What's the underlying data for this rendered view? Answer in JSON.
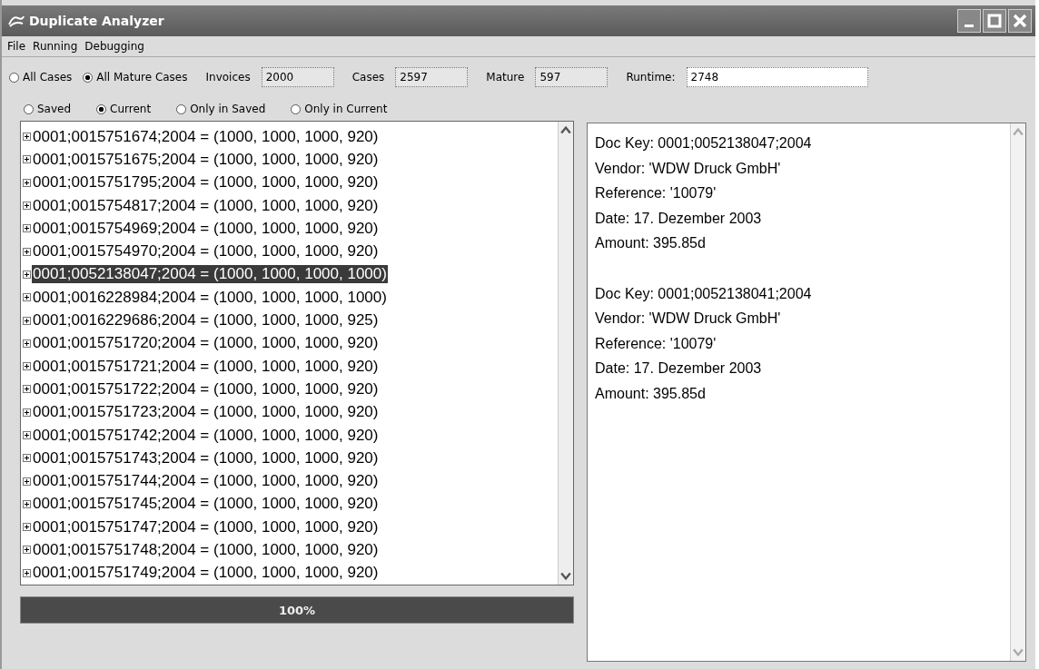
{
  "window": {
    "title": "Duplicate Analyzer"
  },
  "menu": [
    "File",
    "Running",
    "Debugging"
  ],
  "scope": [
    {
      "label": "All Cases",
      "selected": false
    },
    {
      "label": "All Mature Cases",
      "selected": true
    }
  ],
  "stats": [
    {
      "label": "Invoices",
      "value": "2000"
    },
    {
      "label": "Cases",
      "value": "2597"
    },
    {
      "label": "Mature",
      "value": "597"
    },
    {
      "label": "Runtime:",
      "value": "2748"
    }
  ],
  "view": [
    {
      "label": "Saved",
      "selected": false
    },
    {
      "label": "Current",
      "selected": true
    },
    {
      "label": "Only in Saved",
      "selected": false
    },
    {
      "label": "Only in Current",
      "selected": false
    }
  ],
  "cases": [
    {
      "text": "0001;0015751674;2004 = (1000, 1000, 1000, 920)",
      "selected": false
    },
    {
      "text": "0001;0015751675;2004 = (1000, 1000, 1000, 920)",
      "selected": false
    },
    {
      "text": "0001;0015751795;2004 = (1000, 1000, 1000, 920)",
      "selected": false
    },
    {
      "text": "0001;0015754817;2004 = (1000, 1000, 1000, 920)",
      "selected": false
    },
    {
      "text": "0001;0015754969;2004 = (1000, 1000, 1000, 920)",
      "selected": false
    },
    {
      "text": "0001;0015754970;2004 = (1000, 1000, 1000, 920)",
      "selected": false
    },
    {
      "text": "0001;0052138047;2004 = (1000, 1000, 1000, 1000)",
      "selected": true
    },
    {
      "text": "0001;0016228984;2004 = (1000, 1000, 1000, 1000)",
      "selected": false
    },
    {
      "text": "0001;0016229686;2004 = (1000, 1000, 1000, 925)",
      "selected": false
    },
    {
      "text": "0001;0015751720;2004 = (1000, 1000, 1000, 920)",
      "selected": false
    },
    {
      "text": "0001;0015751721;2004 = (1000, 1000, 1000, 920)",
      "selected": false
    },
    {
      "text": "0001;0015751722;2004 = (1000, 1000, 1000, 920)",
      "selected": false
    },
    {
      "text": "0001;0015751723;2004 = (1000, 1000, 1000, 920)",
      "selected": false
    },
    {
      "text": "0001;0015751742;2004 = (1000, 1000, 1000, 920)",
      "selected": false
    },
    {
      "text": "0001;0015751743;2004 = (1000, 1000, 1000, 920)",
      "selected": false
    },
    {
      "text": "0001;0015751744;2004 = (1000, 1000, 1000, 920)",
      "selected": false
    },
    {
      "text": "0001;0015751745;2004 = (1000, 1000, 1000, 920)",
      "selected": false
    },
    {
      "text": "0001;0015751747;2004 = (1000, 1000, 1000, 920)",
      "selected": false
    },
    {
      "text": "0001;0015751748;2004 = (1000, 1000, 1000, 920)",
      "selected": false
    },
    {
      "text": "0001;0015751749;2004 = (1000, 1000, 1000, 920)",
      "selected": false
    }
  ],
  "progress": {
    "level": 1,
    "label": "100%"
  },
  "details": [
    [
      "Doc Key: 0001;0052138047;2004",
      "Vendor: 'WDW Druck GmbH'",
      "Reference: '10079'",
      "Date: 17. Dezember 2003",
      "Amount: 395.85d"
    ],
    [
      "Doc Key: 0001;0052138041;2004",
      "Vendor: 'WDW Druck GmbH'",
      "Reference: '10079'",
      "Date: 17. Dezember 2003",
      "Amount: 395.85d"
    ]
  ]
}
